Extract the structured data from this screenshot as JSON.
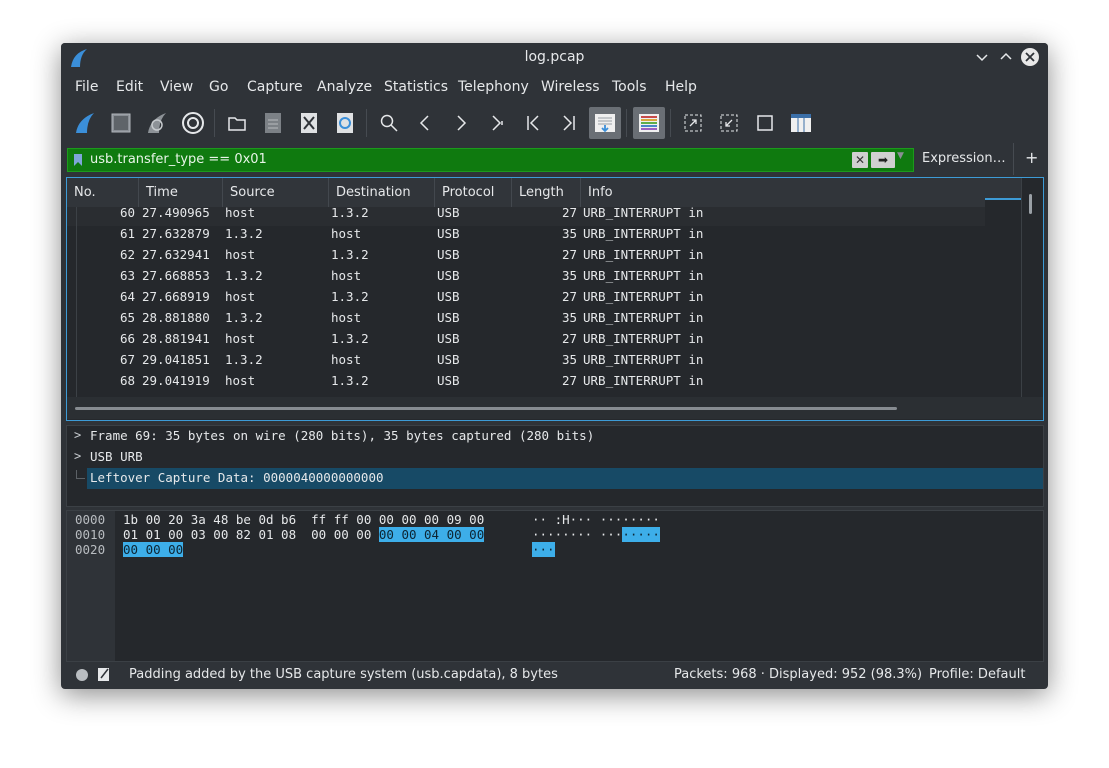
{
  "window": {
    "title": "log.pcap"
  },
  "menu": [
    "File",
    "Edit",
    "View",
    "Go",
    "Capture",
    "Analyze",
    "Statistics",
    "Telephony",
    "Wireless",
    "Tools",
    "Help"
  ],
  "toolbar": {
    "icons": [
      "start-capture-icon",
      "stop-capture-icon",
      "restart-capture-icon",
      "capture-options-icon",
      "open-file-icon",
      "save-file-icon",
      "close-file-icon",
      "reload-file-icon",
      "find-packet-icon",
      "go-previous-icon",
      "go-next-icon",
      "go-to-packet-icon",
      "go-first-icon",
      "go-last-icon",
      "auto-scroll-icon",
      "colorize-icon",
      "zoom-in-icon",
      "zoom-out-icon",
      "normal-size-icon",
      "resize-columns-icon"
    ]
  },
  "filter": {
    "value": "usb.transfer_type == 0x01",
    "expression_label": "Expression…",
    "plus_label": "+",
    "background_color": "#0f7a0f"
  },
  "packet_list": {
    "columns": [
      "No.",
      "Time",
      "Source",
      "Destination",
      "Protocol",
      "Length",
      "Info"
    ],
    "rows": [
      {
        "no": "60",
        "time": "27.490965",
        "source": "host",
        "destination": "1.3.2",
        "protocol": "USB",
        "length": "27",
        "info": "URB_INTERRUPT in"
      },
      {
        "no": "61",
        "time": "27.632879",
        "source": "1.3.2",
        "destination": "host",
        "protocol": "USB",
        "length": "35",
        "info": "URB_INTERRUPT in"
      },
      {
        "no": "62",
        "time": "27.632941",
        "source": "host",
        "destination": "1.3.2",
        "protocol": "USB",
        "length": "27",
        "info": "URB_INTERRUPT in"
      },
      {
        "no": "63",
        "time": "27.668853",
        "source": "1.3.2",
        "destination": "host",
        "protocol": "USB",
        "length": "35",
        "info": "URB_INTERRUPT in"
      },
      {
        "no": "64",
        "time": "27.668919",
        "source": "host",
        "destination": "1.3.2",
        "protocol": "USB",
        "length": "27",
        "info": "URB_INTERRUPT in"
      },
      {
        "no": "65",
        "time": "28.881880",
        "source": "1.3.2",
        "destination": "host",
        "protocol": "USB",
        "length": "35",
        "info": "URB_INTERRUPT in"
      },
      {
        "no": "66",
        "time": "28.881941",
        "source": "host",
        "destination": "1.3.2",
        "protocol": "USB",
        "length": "27",
        "info": "URB_INTERRUPT in"
      },
      {
        "no": "67",
        "time": "29.041851",
        "source": "1.3.2",
        "destination": "host",
        "protocol": "USB",
        "length": "35",
        "info": "URB_INTERRUPT in"
      },
      {
        "no": "68",
        "time": "29.041919",
        "source": "host",
        "destination": "1.3.2",
        "protocol": "USB",
        "length": "27",
        "info": "URB_INTERRUPT in"
      }
    ]
  },
  "details": [
    {
      "text": "Frame 69: 35 bytes on wire (280 bits), 35 bytes captured (280 bits)",
      "expandable": true,
      "selected": false
    },
    {
      "text": "USB URB",
      "expandable": true,
      "selected": false
    },
    {
      "text": "Leftover Capture Data: 0000040000000000",
      "expandable": false,
      "selected": true
    }
  ],
  "bytes": {
    "rows": [
      {
        "offset": "0000",
        "hex": "1b 00 20 3a 48 be 0d b6  ff ff 00 00 00 00 09 00",
        "hex_hl": "",
        "ascii": "·· :H··· ········",
        "ascii_hl": ""
      },
      {
        "offset": "0010",
        "hex": "01 01 00 03 00 82 01 08  00 00 00 ",
        "hex_hl": "00 00 04 00 00",
        "ascii": "········ ···",
        "ascii_hl": "·····"
      },
      {
        "offset": "0020",
        "hex": "",
        "hex_hl": "00 00 00",
        "ascii": "",
        "ascii_hl": "···"
      }
    ]
  },
  "status": {
    "message": "Padding added by the USB capture system (usb.capdata), 8 bytes",
    "packets": "Packets: 968 · Displayed: 952 (98.3%)",
    "profile": "Profile: Default"
  },
  "colors": {
    "accent": "#3daee9",
    "selection": "#174a66",
    "filter_ok": "#0f7a0f"
  }
}
